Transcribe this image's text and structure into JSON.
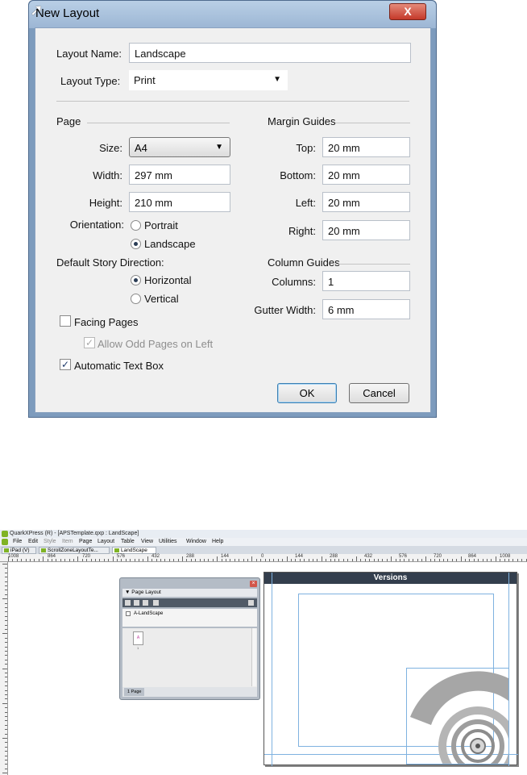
{
  "dialog": {
    "title": "New Layout",
    "close_label": "X",
    "layout_name_label": "Layout Name:",
    "layout_name_value": "Landscape",
    "layout_type_label": "Layout Type:",
    "layout_type_value": "Print",
    "page": {
      "section_label": "Page",
      "size_label": "Size:",
      "size_value": "A4",
      "width_label": "Width:",
      "width_value": "297 mm",
      "height_label": "Height:",
      "height_value": "210 mm",
      "orientation_label": "Orientation:",
      "portrait_label": "Portrait",
      "landscape_label": "Landscape",
      "orientation_selected": "Landscape",
      "story_direction_label": "Default Story Direction:",
      "horizontal_label": "Horizontal",
      "vertical_label": "Vertical",
      "story_direction_selected": "Horizontal",
      "facing_pages_label": "Facing Pages",
      "facing_pages_checked": false,
      "allow_odd_label": "Allow Odd Pages on Left",
      "allow_odd_checked": true,
      "auto_text_box_label": "Automatic Text Box",
      "auto_text_box_checked": true
    },
    "margin_guides": {
      "section_label": "Margin Guides",
      "top_label": "Top:",
      "top_value": "20 mm",
      "bottom_label": "Bottom:",
      "bottom_value": "20 mm",
      "left_label": "Left:",
      "left_value": "20 mm",
      "right_label": "Right:",
      "right_value": "20 mm"
    },
    "column_guides": {
      "section_label": "Column Guides",
      "columns_label": "Columns:",
      "columns_value": "1",
      "gutter_label": "Gutter Width:",
      "gutter_value": "6 mm"
    },
    "ok_label": "OK",
    "cancel_label": "Cancel"
  },
  "quark": {
    "window_title": "QuarkXPress (R) - [APSTemplate.qxp : LandScape]",
    "menu": [
      "File",
      "Edit",
      "Style",
      "Item",
      "Page",
      "Layout",
      "Table",
      "View",
      "Utilities",
      "Window",
      "Help"
    ],
    "tabs": [
      "iPad (V)",
      "ScrollZoneLayoutTe...",
      "LandScape"
    ],
    "ruler_labels": [
      "1008",
      "864",
      "720",
      "576",
      "432",
      "288",
      "144",
      "0",
      "144",
      "288",
      "432",
      "576",
      "720",
      "864",
      "1008"
    ],
    "page_banner": "Versions",
    "palette": {
      "title": "Page Layout",
      "master_item": "A-LandScape",
      "thumb_label": "A",
      "page_number": "1",
      "page_count": "1 Page"
    }
  }
}
